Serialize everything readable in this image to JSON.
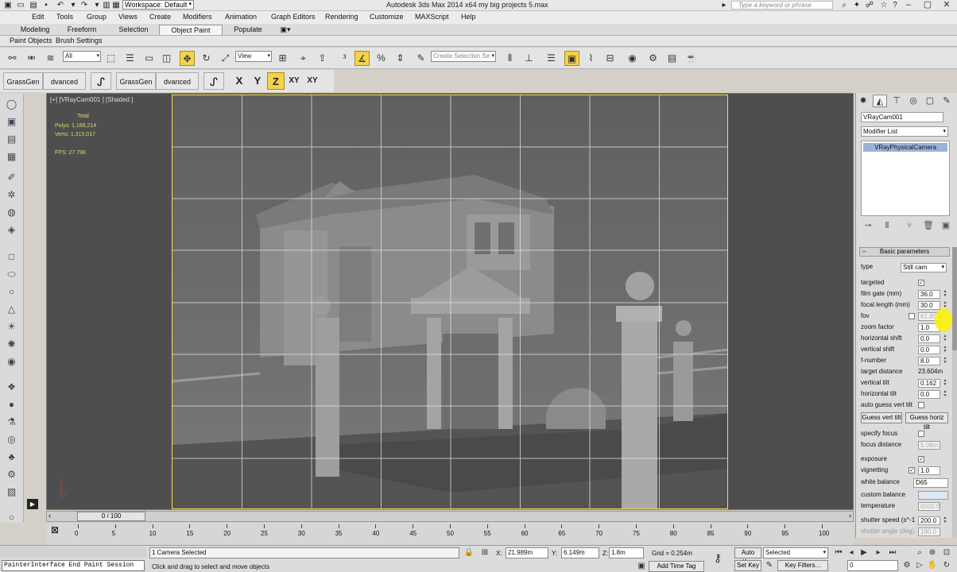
{
  "titlebar": {
    "workspace": "Workspace: Default",
    "app_title": "Autodesk 3ds Max  2014 x64      my big projects 5.max",
    "search_placeholder": "Type a keyword or phrase"
  },
  "menus": [
    {
      "label": "Edit"
    },
    {
      "label": "Tools"
    },
    {
      "label": "Group"
    },
    {
      "label": "Views"
    },
    {
      "label": "Create"
    },
    {
      "label": "Modifiers"
    },
    {
      "label": "Animation"
    },
    {
      "label": "Graph Editors"
    },
    {
      "label": "Rendering"
    },
    {
      "label": "Customize"
    },
    {
      "label": "MAXScript"
    },
    {
      "label": "Help"
    }
  ],
  "ribbon": {
    "tabs": [
      {
        "label": "Modeling"
      },
      {
        "label": "Freeform"
      },
      {
        "label": "Selection"
      },
      {
        "label": "Object Paint"
      },
      {
        "label": "Populate"
      }
    ],
    "active_tab": "Object Paint",
    "sub_items": [
      {
        "label": "Paint Objects"
      },
      {
        "label": "Brush Settings"
      }
    ]
  },
  "toolbar": {
    "selection_filter": "All",
    "ref_coord": "View",
    "named_selection_placeholder": "Create Selection Se"
  },
  "paint_toolbar": {
    "buttons": [
      {
        "label": "GrassGen"
      },
      {
        "label": "dvanced Paint"
      },
      {
        "label": "GrassGen"
      },
      {
        "label": "dvanced Paint"
      }
    ],
    "axes": [
      {
        "label": "X"
      },
      {
        "label": "Y"
      },
      {
        "label": "Z"
      },
      {
        "label": "XY"
      },
      {
        "label": "XY"
      }
    ],
    "active_axis": "Z"
  },
  "viewport": {
    "label": "[+] [VRayCam001 ] [Shaded ]",
    "stats": {
      "total_label": "Total",
      "polys": "Polys:   1,188,214",
      "verts": "Verts:   1,315,017",
      "fps": "FPS:     27.798"
    }
  },
  "command_panel": {
    "object_name": "VRayCam001",
    "modifier_list": "Modifier List",
    "stack_entry": "VRayPhysicalCamera",
    "rollout_title": "Basic parameters",
    "type_label": "type",
    "type_value": "Still cam",
    "params": {
      "targeted": "targeted",
      "film_gate": {
        "label": "film gate (mm)",
        "value": "36.0"
      },
      "focal_length": {
        "label": "focal length (mm)",
        "value": "30.0"
      },
      "fov": {
        "label": "fov",
        "value": "61.853"
      },
      "zoom_factor": {
        "label": "zoom factor",
        "value": "1.0"
      },
      "horizontal_shift": {
        "label": "horizontal shift",
        "value": "0.0"
      },
      "vertical_shift": {
        "label": "vertical shift",
        "value": "0.0"
      },
      "f_number": {
        "label": "f-number",
        "value": "8.0"
      },
      "target_distance": {
        "label": "target distance",
        "value": "23.604m"
      },
      "vertical_tilt": {
        "label": "vertical tilt",
        "value": "0.162"
      },
      "horizontal_tilt": {
        "label": "horizontal tilt",
        "value": "0.0"
      },
      "auto_guess": "auto guess vert tilt",
      "guess_vert": "Guess vert tilt",
      "guess_horiz": "Guess horiz tilt",
      "specify_focus": "specify focus",
      "focus_distance": {
        "label": "focus distance",
        "value": "5.08m"
      },
      "exposure": "exposure",
      "vignetting": {
        "label": "vignetting",
        "value": "1.0"
      },
      "white_balance": {
        "label": "white balance",
        "value": "D65"
      },
      "custom_balance": "custom balance",
      "temperature": {
        "label": "temperature",
        "value": "6500.0"
      },
      "shutter_speed": {
        "label": "shutter speed (s^-1",
        "value": "200.0"
      },
      "shutter_angle": {
        "label": "shutter angle (deg)",
        "value": "180.0"
      }
    }
  },
  "timeline": {
    "frame": "0 / 100",
    "ticks": [
      0,
      5,
      10,
      15,
      20,
      25,
      30,
      35,
      40,
      45,
      50,
      55,
      60,
      65,
      70,
      75,
      80,
      85,
      90,
      95,
      100
    ]
  },
  "status": {
    "listener": "PainterInterface End Paint Session",
    "selection": "1 Camera Selected",
    "prompt": "Click and drag to select and move objects",
    "x": "21.989m",
    "y": "6.149m",
    "z": "1.8m",
    "grid": "Grid = 0.254m",
    "add_time_tag": "Add Time Tag",
    "auto_key": "Auto Key",
    "set_key": "Set Key",
    "selected": "Selected",
    "key_filters": "Key Filters...",
    "frame_field": "0"
  },
  "colors": {
    "highlight": "#f4d24a",
    "safe_frame": "#f2e04a",
    "stat_text": "#d6d66a",
    "stack_entry": "#9bb3d6"
  }
}
